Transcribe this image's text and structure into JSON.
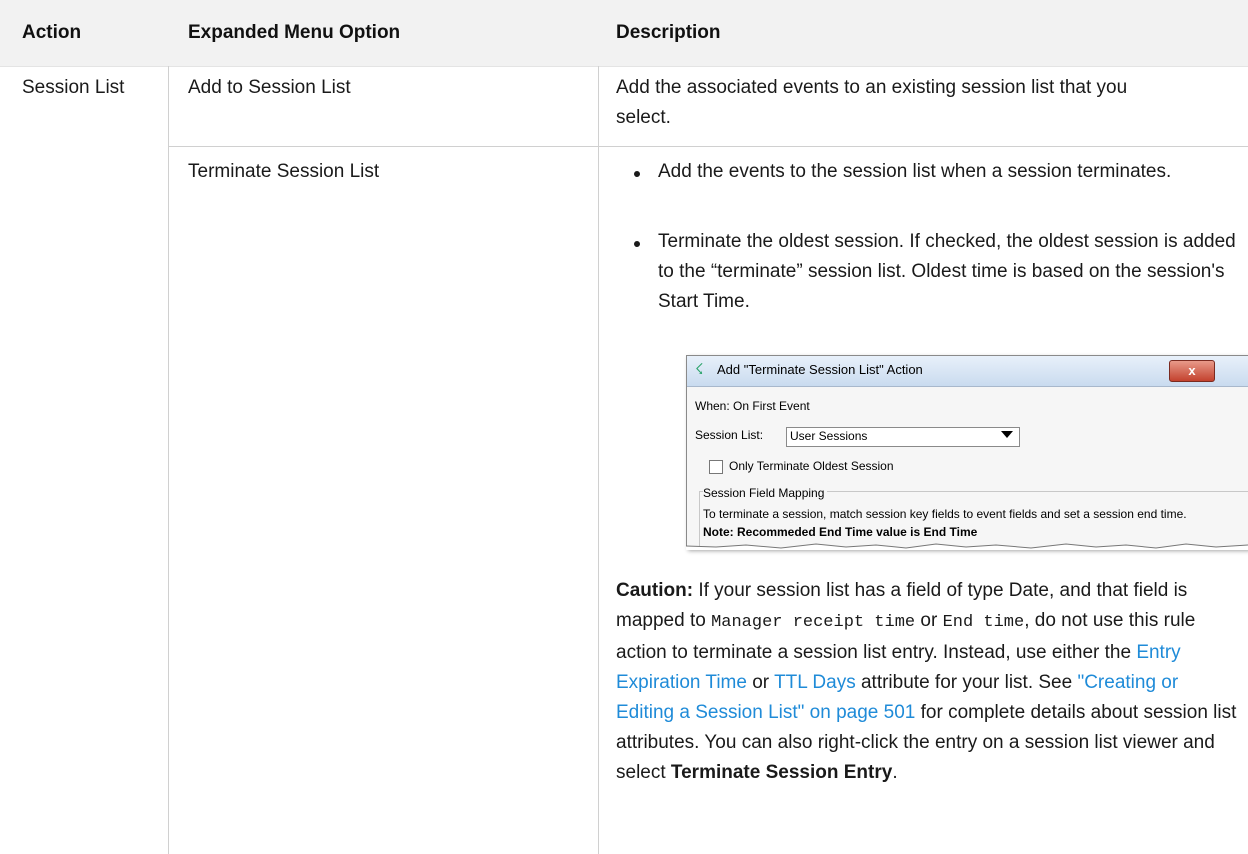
{
  "table": {
    "headers": {
      "action": "Action",
      "option": "Expanded Menu Option",
      "description": "Description"
    },
    "rows": {
      "action": "Session List",
      "row1": {
        "option": "Add to Session List",
        "description": "Add the associated events to an existing session list that you select."
      },
      "row2": {
        "option": "Terminate Session List",
        "bullet1": "Add the events to the session list when a session terminates.",
        "bullet2": "Terminate the oldest session. If checked, the oldest session is added to the “terminate” session list. Oldest time is based on the session's Start Time.",
        "caution": {
          "label": "Caution:",
          "t1": " If your session list has a field of type Date, and that field is mapped to ",
          "code1": "Manager receipt time",
          "t2": " or ",
          "code2": "End time",
          "t3": ", do not use this rule action to terminate a session list entry. Instead, use either the ",
          "link1": "Entry Expiration Time",
          "t4": " or ",
          "link2": "TTL Days",
          "t5": " attribute for your list. See ",
          "link3": "\"Creating or Editing a Session List\" on page 501",
          "t6": " for complete details about session list attributes. You can also right-click the entry on a session list viewer and select ",
          "bold_end": "Terminate Session Entry",
          "t7": "."
        }
      }
    }
  },
  "dialog": {
    "title": "Add \"Terminate Session List\" Action",
    "when": "When: On First Event",
    "session_list_label": "Session List:",
    "session_list_value": "User Sessions",
    "checkbox_label": "Only Terminate Oldest Session",
    "group_label": "Session Field Mapping",
    "group_text": "To terminate a session, match session key fields to event fields and set a session end time.",
    "note": "Note: Recommeded End Time value is End Time",
    "close_glyph": "x",
    "icon_glyph": "☇"
  },
  "colors": {
    "header_bg": "#f2f2f2",
    "link": "#1f8bd8",
    "grid": "#d0d0d0"
  }
}
